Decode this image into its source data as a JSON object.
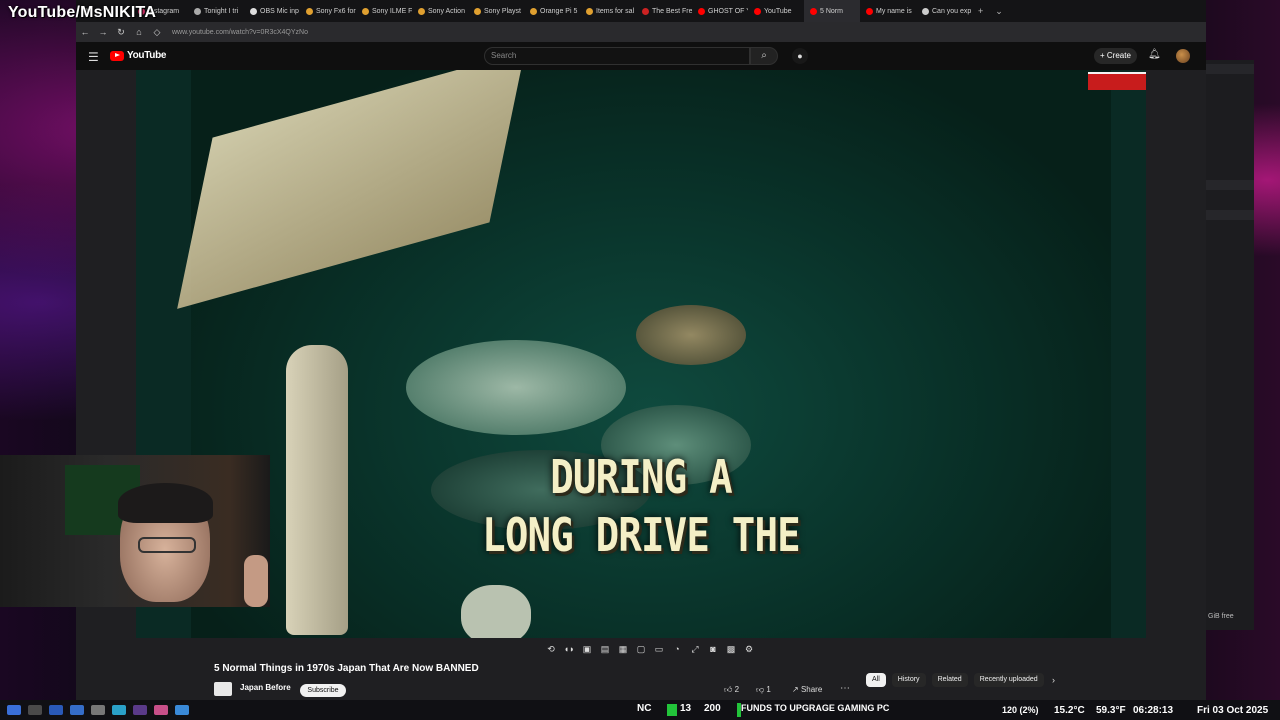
{
  "overlay": {
    "streamer_name": "YouTube/MsNIKITA"
  },
  "browser": {
    "tabs": [
      {
        "label": "",
        "color": "#888888"
      },
      {
        "label": "Instagram",
        "color": "#e1306c"
      },
      {
        "label": "Tonight I tri",
        "color": "#aaaaaa"
      },
      {
        "label": "OBS Mic inp",
        "color": "#dddddd"
      },
      {
        "label": "Sony Fx6 for",
        "color": "#e0a030"
      },
      {
        "label": "Sony ILME F",
        "color": "#e0a030"
      },
      {
        "label": "Sony Action",
        "color": "#e0a030"
      },
      {
        "label": "Sony Playst",
        "color": "#e0a030"
      },
      {
        "label": "Orange Pi 5",
        "color": "#e0a030"
      },
      {
        "label": "Items for sal",
        "color": "#e0a030"
      },
      {
        "label": "The Best Fre",
        "color": "#cc2222"
      },
      {
        "label": "GHOST OF Y",
        "color": "#ff0000"
      },
      {
        "label": "YouTube",
        "color": "#ff0000"
      },
      {
        "label": "5 Norm",
        "color": "#ff0000",
        "active": true
      },
      {
        "label": "My name is",
        "color": "#ff0000"
      },
      {
        "label": "Can you exp",
        "color": "#cccccc"
      }
    ],
    "url": "www.youtube.com/watch?v=0R3cX4QYzNo"
  },
  "youtube": {
    "logo_text": "YouTube",
    "search_placeholder": "Search",
    "create_label": "Create",
    "caption_line1": "DURING A",
    "caption_line2": "LONG DRIVE THE",
    "video_title": "5 Normal Things in 1970s Japan That Are Now BANNED",
    "channel": "Japan Before",
    "subscribe_label": "Subscribe",
    "likes": "2",
    "dislikes": "1",
    "share_label": "Share",
    "chips": [
      "All",
      "History",
      "Related",
      "Recently uploaded"
    ]
  },
  "side_panel": {
    "footer_text": "GiB free"
  },
  "taskbar": {
    "nc": "NC",
    "count_a": "13",
    "count_b": "200",
    "goal_text": "FUNDS TO UPGRAGE GAMING PC",
    "fps": "120 (2%)",
    "temp": "15.2°C",
    "temp2": "59.3°F",
    "time": "06:28:13",
    "date": "Fri 03 Oct 2025"
  }
}
